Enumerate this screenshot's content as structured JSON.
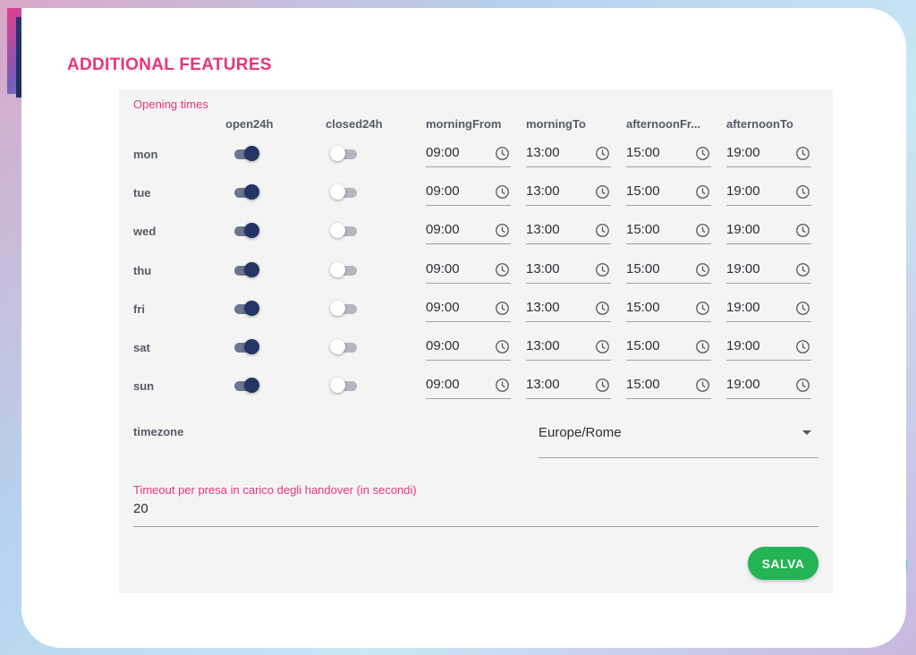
{
  "header": {
    "title": "ADDITIONAL FEATURES"
  },
  "opening_times": {
    "section_label": "Opening times",
    "columns": [
      "open24h",
      "closed24h",
      "morningFrom",
      "morningTo",
      "afternoonFr...",
      "afternoonTo"
    ],
    "days": [
      {
        "day": "mon",
        "open24h": true,
        "closed24h": false,
        "morningFrom": "09:00",
        "morningTo": "13:00",
        "afternoonFrom": "15:00",
        "afternoonTo": "19:00"
      },
      {
        "day": "tue",
        "open24h": true,
        "closed24h": false,
        "morningFrom": "09:00",
        "morningTo": "13:00",
        "afternoonFrom": "15:00",
        "afternoonTo": "19:00"
      },
      {
        "day": "wed",
        "open24h": true,
        "closed24h": false,
        "morningFrom": "09:00",
        "morningTo": "13:00",
        "afternoonFrom": "15:00",
        "afternoonTo": "19:00"
      },
      {
        "day": "thu",
        "open24h": true,
        "closed24h": false,
        "morningFrom": "09:00",
        "morningTo": "13:00",
        "afternoonFrom": "15:00",
        "afternoonTo": "19:00"
      },
      {
        "day": "fri",
        "open24h": true,
        "closed24h": false,
        "morningFrom": "09:00",
        "morningTo": "13:00",
        "afternoonFrom": "15:00",
        "afternoonTo": "19:00"
      },
      {
        "day": "sat",
        "open24h": true,
        "closed24h": false,
        "morningFrom": "09:00",
        "morningTo": "13:00",
        "afternoonFrom": "15:00",
        "afternoonTo": "19:00"
      },
      {
        "day": "sun",
        "open24h": true,
        "closed24h": false,
        "morningFrom": "09:00",
        "morningTo": "13:00",
        "afternoonFrom": "15:00",
        "afternoonTo": "19:00"
      }
    ]
  },
  "timezone": {
    "label": "timezone",
    "value": "Europe/Rome"
  },
  "timeout": {
    "label": "Timeout per presa in carico degli handover (in secondi)",
    "value": "20"
  },
  "actions": {
    "save_label": "SALVA"
  },
  "icons": {
    "time_field": "clock-icon",
    "select": "caret-down-icon"
  },
  "colors": {
    "accent": "#e8347f",
    "toggle_on": "#243464",
    "save": "#22b455",
    "cyan": "#16c6ea"
  }
}
